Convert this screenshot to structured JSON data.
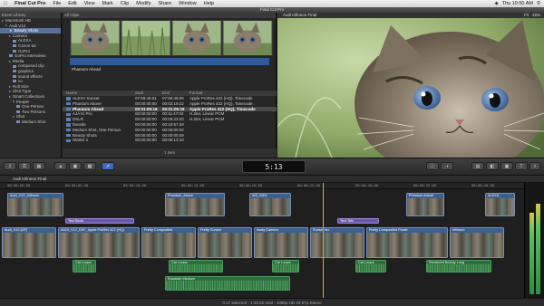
{
  "menubar": {
    "app": "Final Cut Pro",
    "items": [
      "File",
      "Edit",
      "View",
      "Mark",
      "Clip",
      "Modify",
      "Share",
      "Window",
      "Help"
    ],
    "clock": "Thu 10:50 AM"
  },
  "window": {
    "title": "Final Cut Pro"
  },
  "library": {
    "header": "Event Library",
    "items": [
      {
        "label": "Macintosh HD",
        "level": 0,
        "type": "drive"
      },
      {
        "label": "Audi V12",
        "level": 1,
        "type": "event"
      },
      {
        "label": "Beauty Shots",
        "level": 2,
        "type": "star",
        "selected": true
      },
      {
        "label": "Camera",
        "level": 2,
        "type": "folder"
      },
      {
        "label": "ALEXA",
        "level": 3,
        "type": "keyword"
      },
      {
        "label": "Canon 5d",
        "level": 3,
        "type": "keyword"
      },
      {
        "label": "GoPro",
        "level": 3,
        "type": "keyword"
      },
      {
        "label": "GoPro Interviews",
        "level": 2,
        "type": "keyword"
      },
      {
        "label": "Media",
        "level": 2,
        "type": "folder"
      },
      {
        "label": "composed clip",
        "level": 3,
        "type": "keyword"
      },
      {
        "label": "graphics",
        "level": 3,
        "type": "keyword"
      },
      {
        "label": "sound effects",
        "level": 3,
        "type": "keyword"
      },
      {
        "label": "vo",
        "level": 3,
        "type": "keyword"
      },
      {
        "label": "Roll Size",
        "level": 2,
        "type": "folder"
      },
      {
        "label": "Shot Type",
        "level": 2,
        "type": "folder"
      },
      {
        "label": "Smart Collections",
        "level": 2,
        "type": "folder"
      },
      {
        "label": "People",
        "level": 3,
        "type": "folder"
      },
      {
        "label": "One Person",
        "level": 4,
        "type": "keyword"
      },
      {
        "label": "Two Persons",
        "level": 4,
        "type": "keyword"
      },
      {
        "label": "Shot",
        "level": 3,
        "type": "folder"
      },
      {
        "label": "Medium Shot",
        "level": 4,
        "type": "keyword"
      }
    ]
  },
  "browser": {
    "header": "All Clips",
    "filmstrip_clip": "Phantom Ahead",
    "columns": {
      "name": "Name",
      "start": "Start",
      "end": "End",
      "format": "Format"
    },
    "rows": [
      {
        "name": "ALEXA Sunset",
        "start": "07:58:46:01",
        "end": "07:58:48:08",
        "format": "Apple ProRes 422 (HQ), Timecode",
        "selected": false
      },
      {
        "name": "Phantom Above",
        "start": "00:00:00:00",
        "end": "00:02:19:22",
        "format": "Apple ProRes 422 (HQ), Timecode",
        "selected": false
      },
      {
        "name": "Phantom Ahead",
        "start": "00:01:05:16",
        "end": "00:01:05:16",
        "format": "Apple ProRes 422 (HQ), Timecode",
        "selected": true
      },
      {
        "name": "AJA Ki Pro",
        "start": "00:00:00:00",
        "end": "00:11:47:03",
        "format": "H.264, Linear PCM",
        "selected": false
      },
      {
        "name": "DSLR",
        "start": "00:00:00:00",
        "end": "00:09:23:20",
        "format": "H.264, Linear PCM",
        "selected": false
      },
      {
        "name": "favorite",
        "start": "00:00:00:00",
        "end": "00:10:57:29",
        "format": "",
        "selected": false
      },
      {
        "name": "Medium Shot, One Person",
        "start": "00:00:00:00",
        "end": "00:00:00:02",
        "format": "",
        "selected": false
      },
      {
        "name": "Beauty Shots",
        "start": "00:00:00:00",
        "end": "00:00:00:09",
        "format": "",
        "selected": false
      },
      {
        "name": "Starter 1",
        "start": "00:00:00:00",
        "end": "00:05:13:10",
        "format": "",
        "selected": false
      }
    ],
    "footer": "1 item"
  },
  "viewer": {
    "title": "Audi Infineon Final",
    "zoom": "Fit",
    "zoom_level": "45%"
  },
  "toolbar": {
    "timecode": "5:13"
  },
  "timeline": {
    "project": "Audi Infineon Final",
    "ruler_ticks": [
      "00:00:00:00",
      "00:00:05:00",
      "00:00:10:00",
      "00:00:15:00",
      "00:00:20:00",
      "00:00:25:00",
      "00:00:30:00",
      "00:00:35:00",
      "00:00:40:00",
      "00:00:45:00"
    ],
    "connected_above": [
      {
        "name": "Audi_V12_Infineon",
        "track": 0
      },
      {
        "name": "Phantom_Above",
        "track": 0
      },
      {
        "name": "WS_0001",
        "track": 0
      },
      {
        "name": "Phantom Ahead",
        "track": 0
      },
      {
        "name": "ALEXA",
        "track": 0
      }
    ],
    "titles": [
      "Text Block",
      "Text Title"
    ],
    "primary": [
      {
        "name": "Audi_V12 (DP)",
        "wide": false
      },
      {
        "name": "AUDI_V12_DSF_Apple ProRes 422 (HQ)",
        "wide": true
      },
      {
        "name": "Pretty Composited",
        "wide": false
      },
      {
        "name": "Pretty Sunset",
        "wide": false
      },
      {
        "name": "Away Camera",
        "wide": false
      },
      {
        "name": "Sunset run",
        "wide": false
      },
      {
        "name": "Pretty Composited Finale",
        "wide": true
      },
      {
        "name": "Infineon",
        "wide": false
      }
    ],
    "audio": [
      {
        "name": "Car Loops"
      },
      {
        "name": "Car Loops"
      },
      {
        "name": "Car Loops"
      },
      {
        "name": "Car Loops"
      },
      {
        "name": "Rendered Beauty Long"
      }
    ],
    "music": "Roadster Medium"
  },
  "status": {
    "text": "0:17 selected - 1:45:52 total - 1080p HD 29.97p Stereo"
  },
  "colors": {
    "accent": "#3b6ac2",
    "video_clip": "#3b5f8f",
    "audio_clip": "#2f6d3e",
    "title_clip": "#6a57a8",
    "playhead": "#e0b400"
  }
}
